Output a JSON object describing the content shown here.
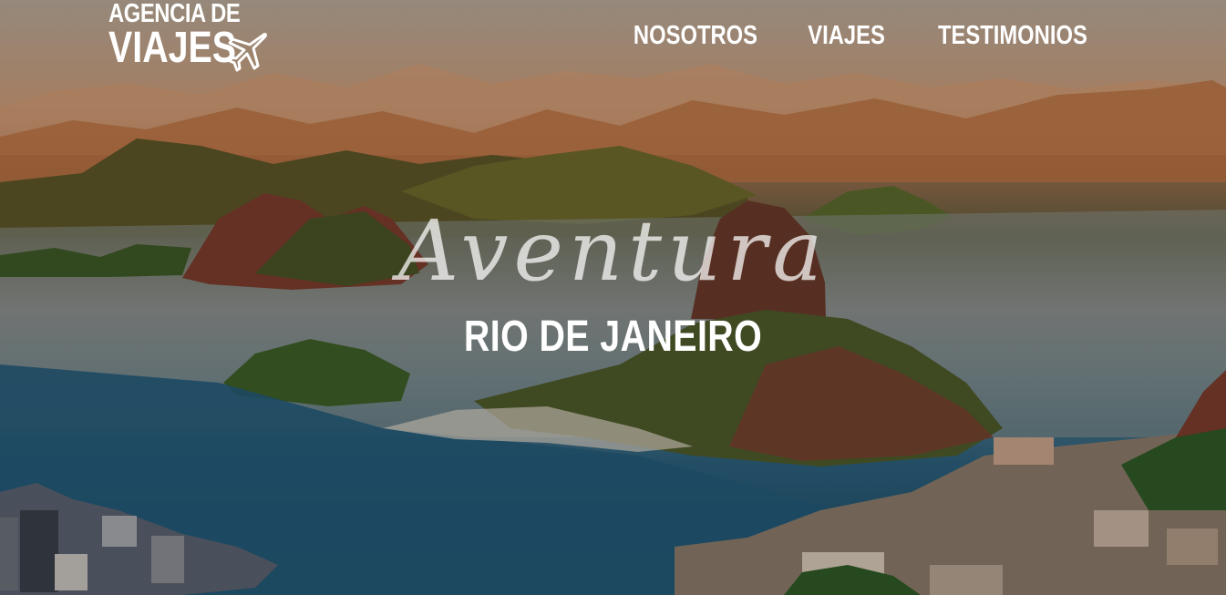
{
  "header": {
    "logo_line1": "AGENCIA DE",
    "logo_line2": "VIAJES",
    "logo_icon": "airplane-icon"
  },
  "nav": {
    "items": [
      {
        "label": "NOSOTROS"
      },
      {
        "label": "VIAJES"
      },
      {
        "label": "TESTIMONIOS"
      }
    ]
  },
  "hero": {
    "tagline": "Aventura",
    "subtitle": "RIO DE JANEIRO"
  },
  "colors": {
    "text": "#ffffff",
    "sea": "#2b5f7b",
    "sky": "#b7a796"
  }
}
